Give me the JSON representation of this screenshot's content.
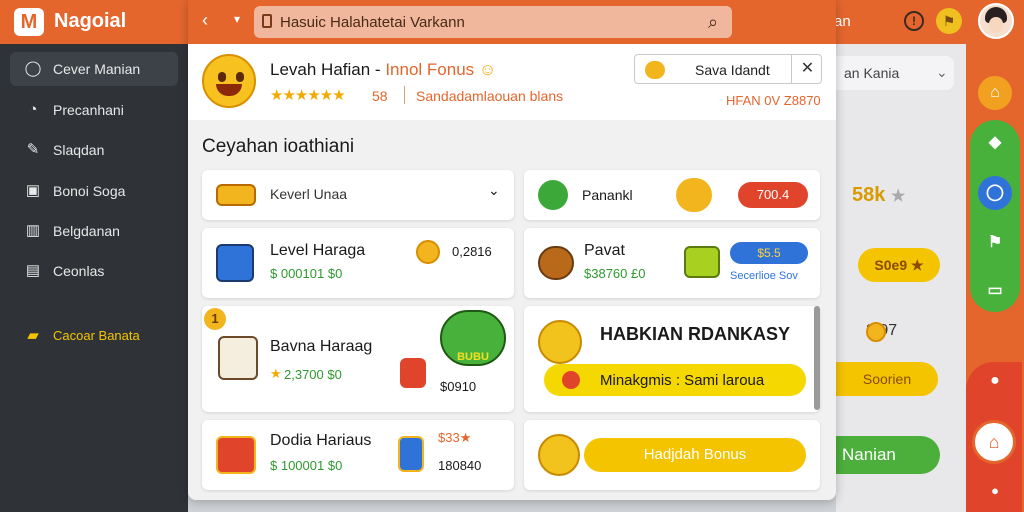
{
  "app": {
    "logo": "M",
    "title": "Nagoial"
  },
  "topbar": {
    "badge_icon": "trophy-icon",
    "badge_text": "an",
    "info_icon": "info-icon",
    "flag_icon": "flag-icon"
  },
  "sidebar": {
    "items": [
      {
        "label": "Cever Manian",
        "icon": "chat-icon",
        "glyph": "◯"
      },
      {
        "label": "Precanhani",
        "icon": "clock-icon",
        "glyph": "◔"
      },
      {
        "label": "Slaqdan",
        "icon": "pen-icon",
        "glyph": "✎"
      },
      {
        "label": "Bonoi Soga",
        "icon": "image-icon",
        "glyph": "▣"
      },
      {
        "label": "Belgdanan",
        "icon": "book-icon",
        "glyph": "▥"
      },
      {
        "label": "Ceonlas",
        "icon": "card-icon",
        "glyph": "▤"
      },
      {
        "label": "Cacoar Banata",
        "icon": "gift-icon",
        "glyph": "▰"
      }
    ]
  },
  "search": {
    "value": "Hasuic Halahatetai Varkann",
    "button_glyph": "⌕"
  },
  "profile": {
    "name_part1": "Levah Hafian -",
    "name_part2": "Innol Fonus",
    "stars": "★★★★★★",
    "star_score": "58",
    "subtitle": "Sandadamlaouan blans"
  },
  "save_panel": {
    "label": "Sava Idandt",
    "close": "✕",
    "id_text": "HFAN 0V Z8870"
  },
  "section_title": "Ceyahan ioathiani",
  "dropdown": {
    "value": "Keverl Unaa",
    "chevron": "⌄"
  },
  "cards": {
    "panank": {
      "title": "Panankl",
      "button": "700.4"
    },
    "level": {
      "title": "Level Haraga",
      "price": "$ 000101 $0",
      "coin_value": "0,2816"
    },
    "pavat": {
      "title": "Pavat",
      "price": "$38760 £0",
      "tag": "$5.5",
      "tag_label": "Secerlioe Sov"
    },
    "bavna": {
      "badge": "1",
      "title": "Bavna Haraag",
      "stars": "★",
      "rating": "2,3700 $0",
      "mascot": "BUBU",
      "price": "$0910"
    },
    "habkian": {
      "title": "HABKIAN RDANKASY",
      "bar": "Minakgmis : Sami laroua"
    },
    "dodia": {
      "title": "Dodia Hariaus",
      "price": "$ 100001 $0",
      "tag": "$33★",
      "value": "180840"
    },
    "bonus": {
      "label": "Hadjdah Bonus"
    }
  },
  "background_panel": {
    "select_value": "an Kania",
    "rating": "58k",
    "pill1": "S0e9 ★",
    "price": "2.97",
    "pill2": "Soorien",
    "pill3": "Nanian"
  },
  "colors": {
    "brand_orange": "#e4662d",
    "sidebar": "#2f3338",
    "accent_yellow": "#f5c400",
    "success_green": "#47b13c",
    "danger_red": "#e0452b",
    "info_blue": "#2f73d9"
  }
}
